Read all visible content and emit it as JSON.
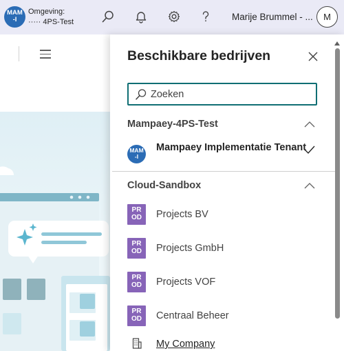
{
  "topbar": {
    "env_avatar": "MAM\n-I",
    "env_label": "Omgeving:",
    "env_value": "····· 4PS-Test",
    "user_name": "Marije Brummel - ...",
    "user_initial": "M",
    "icons": [
      "search-icon",
      "bell-icon",
      "gear-icon",
      "help-icon"
    ]
  },
  "panel": {
    "title": "Beschikbare bedrijven",
    "search_placeholder": "Zoeken",
    "groups": [
      {
        "name": "Mampaey-4PS-Test",
        "items": [
          {
            "icon_text": "MAM\n-I",
            "label": "Mampaey Implementatie Tenant",
            "selected": true,
            "color": "#2b6cb5"
          }
        ]
      },
      {
        "name": "Cloud-Sandbox",
        "items": [
          {
            "icon_text": "PR\nOD",
            "label": "Projects BV",
            "color": "#8764b8"
          },
          {
            "icon_text": "PR\nOD",
            "label": "Projects GmbH",
            "color": "#8764b8"
          },
          {
            "icon_text": "PR\nOD",
            "label": "Projects VOF",
            "color": "#8764b8"
          },
          {
            "icon_text": "PR\nOD",
            "label": "Centraal Beheer",
            "color": "#8764b8"
          }
        ]
      }
    ],
    "footer_link": "My Company"
  },
  "colors": {
    "accent": "#0f6e73",
    "brand": "#2b6cb5",
    "prod": "#8764b8",
    "topbar": "#eaeaf6"
  }
}
